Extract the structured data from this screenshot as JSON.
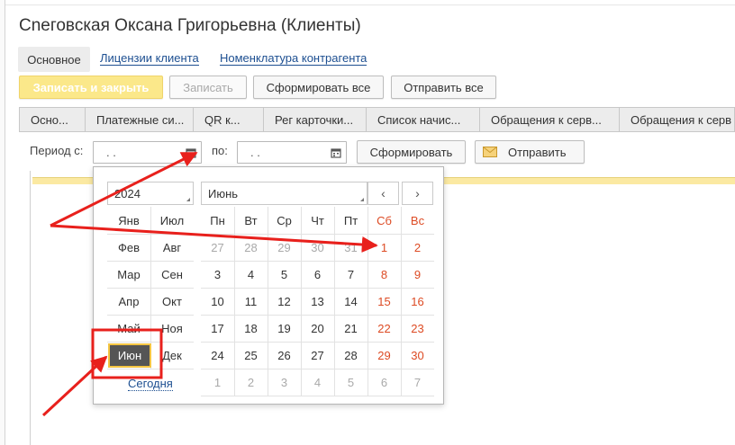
{
  "window": {
    "title": "Сneговская Оксана Григорьевна (Клиенты)"
  },
  "nav": {
    "active": "Основное",
    "links": [
      "Лицензии клиента",
      "Номенклатура контрагента"
    ]
  },
  "toolbar": {
    "write_close": "Записать и закрыть",
    "write": "Записать",
    "form_all": "Сформировать все",
    "send_all": "Отправить все"
  },
  "tabs": [
    "Осно...",
    "Платежные си...",
    "QR к...",
    "Рег карточки...",
    "Список начис...",
    "Обращения к серв...",
    "Обращения к серв"
  ],
  "filter": {
    "period_from_label": "Период с:",
    "period_from_value": ". .",
    "to_label": "по:",
    "to_value": ". .",
    "form_button": "Сформировать",
    "send_button": "Отправить"
  },
  "calendar": {
    "year": "2024",
    "month": "Июнь",
    "months_left": [
      "Янв",
      "Фев",
      "Мар",
      "Апр",
      "Май",
      "Июн"
    ],
    "months_right": [
      "Июл",
      "Авг",
      "Сен",
      "Окт",
      "Ноя",
      "Дек"
    ],
    "selected_month": "Июн",
    "weekdays": [
      "Пн",
      "Вт",
      "Ср",
      "Чт",
      "Пт",
      "Сб",
      "Вс"
    ],
    "weeks": [
      [
        "27",
        "28",
        "29",
        "30",
        "31",
        "1",
        "2"
      ],
      [
        "3",
        "4",
        "5",
        "6",
        "7",
        "8",
        "9"
      ],
      [
        "10",
        "11",
        "12",
        "13",
        "14",
        "15",
        "16"
      ],
      [
        "17",
        "18",
        "19",
        "20",
        "21",
        "22",
        "23"
      ],
      [
        "24",
        "25",
        "26",
        "27",
        "28",
        "29",
        "30"
      ],
      [
        "1",
        "2",
        "3",
        "4",
        "5",
        "6",
        "7"
      ]
    ],
    "today": "Сегодня",
    "prev_icon": "chevron-left-icon",
    "next_icon": "chevron-right-icon"
  },
  "colors": {
    "primary_button": "#fbe88a",
    "link": "#1d4f91",
    "weekend": "#dd4b24",
    "annotation_red": "#e8201c",
    "selected_bg": "#555555",
    "selected_border": "#f4c542"
  }
}
